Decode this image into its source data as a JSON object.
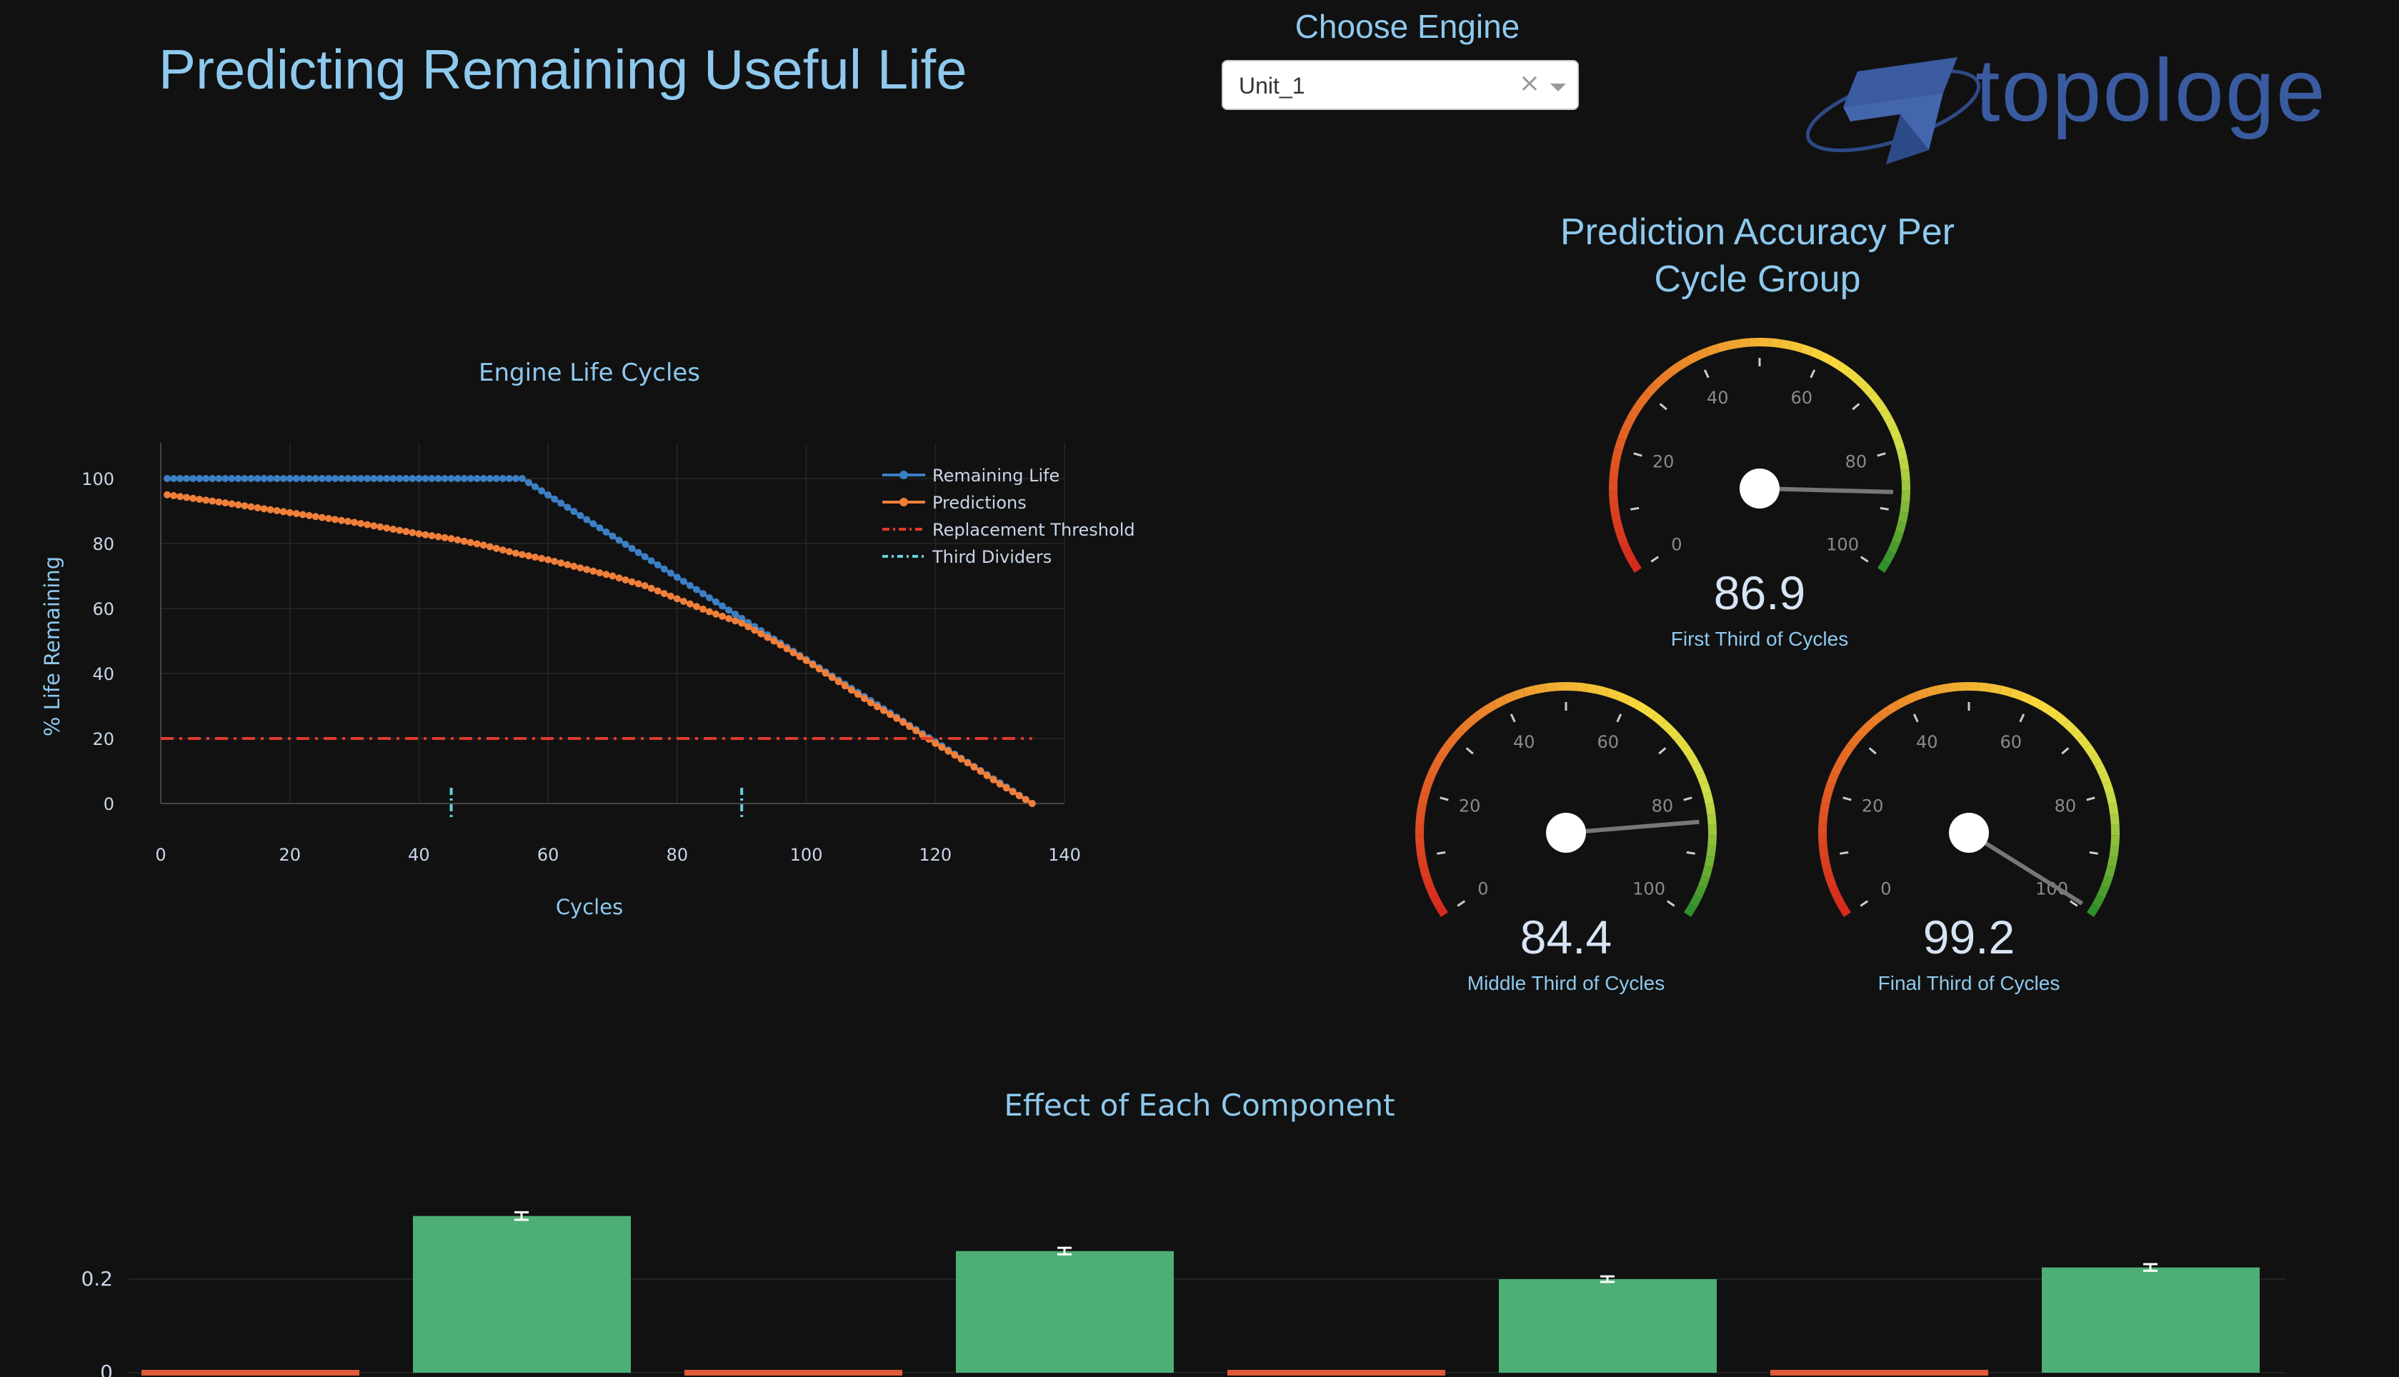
{
  "header": {
    "title": "Predicting Remaining Useful Life",
    "selector_label": "Choose Engine",
    "selected_engine": "Unit_1",
    "clear_symbol": "×",
    "logo_text": "topologe"
  },
  "colors": {
    "background": "#111111",
    "title": "#8ec9ee",
    "remaining_life": "#3c7fc4",
    "predictions": "#f07f3a",
    "threshold": "#e03a2a",
    "dividers": "#5fd3df",
    "bar_positive": "#4daf76",
    "bar_negative": "#e05a3a",
    "logo": "#3a5ba0"
  },
  "chart_data": [
    {
      "type": "line",
      "title": "Engine Life Cycles",
      "xlabel": "Cycles",
      "ylabel": "% Life Remaining",
      "xlim": [
        0,
        140
      ],
      "ylim": [
        0,
        100
      ],
      "xticks": [
        0,
        20,
        40,
        60,
        80,
        100,
        120,
        140
      ],
      "yticks": [
        0,
        20,
        40,
        60,
        80,
        100
      ],
      "legend": "top-right",
      "series": [
        {
          "name": "Remaining Life",
          "style": "line+markers",
          "x": [
            1,
            56,
            135
          ],
          "y": [
            100,
            100,
            0
          ]
        },
        {
          "name": "Predictions",
          "style": "line+markers",
          "x": [
            1,
            10,
            20,
            30,
            40,
            45,
            50,
            55,
            60,
            65,
            70,
            75,
            80,
            85,
            90,
            95,
            100,
            105,
            110,
            115,
            120,
            125,
            130,
            135
          ],
          "y": [
            95,
            92.5,
            89.5,
            86.5,
            83,
            81.5,
            79.5,
            77,
            75,
            72.5,
            70,
            67,
            63,
            59,
            55.5,
            50,
            44,
            37.5,
            31,
            25,
            18.5,
            12.5,
            6,
            0
          ]
        },
        {
          "name": "Replacement Threshold",
          "style": "dashdot",
          "x": [
            0,
            135
          ],
          "y": [
            20,
            20
          ]
        },
        {
          "name": "Third Dividers",
          "style": "dashdot",
          "x": [
            45,
            90
          ],
          "y": [
            0,
            0
          ]
        }
      ]
    },
    {
      "type": "bar",
      "title": "Effect of Each Component",
      "yticks": [
        0,
        0.2
      ],
      "series": [
        {
          "values": [
            0.335,
            0.26,
            0.2,
            0.225
          ],
          "errors": [
            0.008,
            0.007,
            0.006,
            0.007
          ]
        }
      ],
      "visible_groups": 4
    }
  ],
  "gauges": {
    "title_line1": "Prediction Accuracy Per",
    "title_line2": "Cycle Group",
    "range": [
      0,
      100
    ],
    "ticks": [
      "0",
      "20",
      "40",
      "60",
      "80",
      "100"
    ],
    "items": [
      {
        "value": 86.9,
        "value_text": "86.9",
        "label": "First Third of Cycles"
      },
      {
        "value": 84.4,
        "value_text": "84.4",
        "label": "Middle Third of Cycles"
      },
      {
        "value": 99.2,
        "value_text": "99.2",
        "label": "Final Third of Cycles"
      }
    ]
  }
}
